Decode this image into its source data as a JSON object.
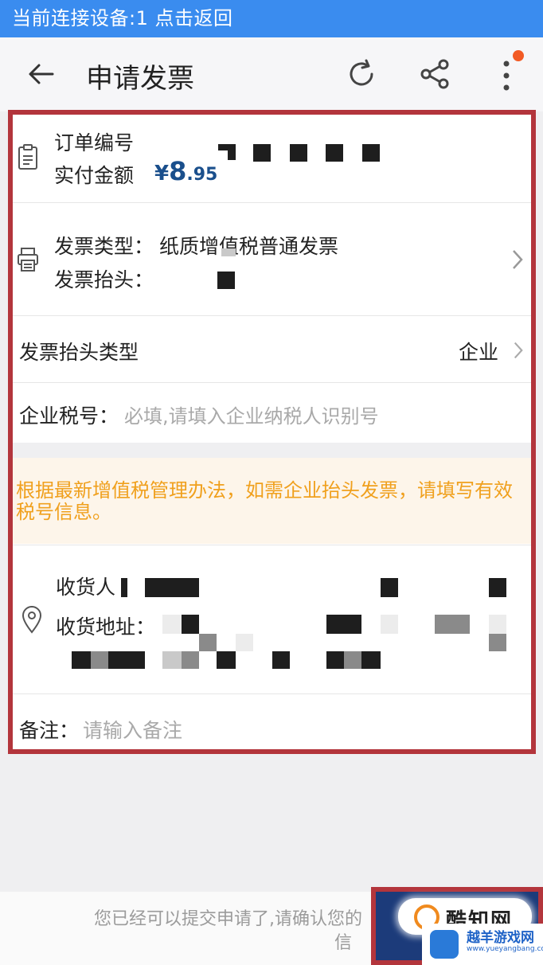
{
  "status_banner": {
    "text": "当前连接设备:1 点击返回"
  },
  "header": {
    "title": "申请发票",
    "icons": [
      "back-arrow-icon",
      "refresh-icon",
      "share-icon",
      "more-vertical-icon"
    ]
  },
  "order": {
    "number_label": "订单编号",
    "amount_label": "实付金额",
    "currency": "¥",
    "amount_int": "8",
    "amount_dec": ".95"
  },
  "invoice": {
    "type_label": "发票类型：",
    "type_value": "纸质增值税普通发票",
    "title_label": "发票抬头："
  },
  "title_type": {
    "label": "发票抬头类型",
    "value": "企业"
  },
  "tax_id": {
    "label": "企业税号：",
    "placeholder": "必填,请填入企业纳税人识别号"
  },
  "notice": {
    "text": "根据最新增值税管理办法，如需企业抬头发票，请填写有效税号信息。"
  },
  "receiver": {
    "name_label": "收货人",
    "address_label": "收货地址："
  },
  "remark": {
    "label": "备注：",
    "placeholder": "请输入备注"
  },
  "footer": {
    "hint_line1": "您已经可以提交申请了,请确认您的",
    "hint_line2": "信"
  },
  "watermark": {
    "logo_text": "酷知网",
    "site_text": "越羊游戏网",
    "site_url": "www.yueyangbang.com"
  },
  "colors": {
    "banner": "#3a8cef",
    "amount": "#1a4f8c",
    "notice_text": "#f0a01d",
    "highlight_frame": "#b3353c"
  }
}
